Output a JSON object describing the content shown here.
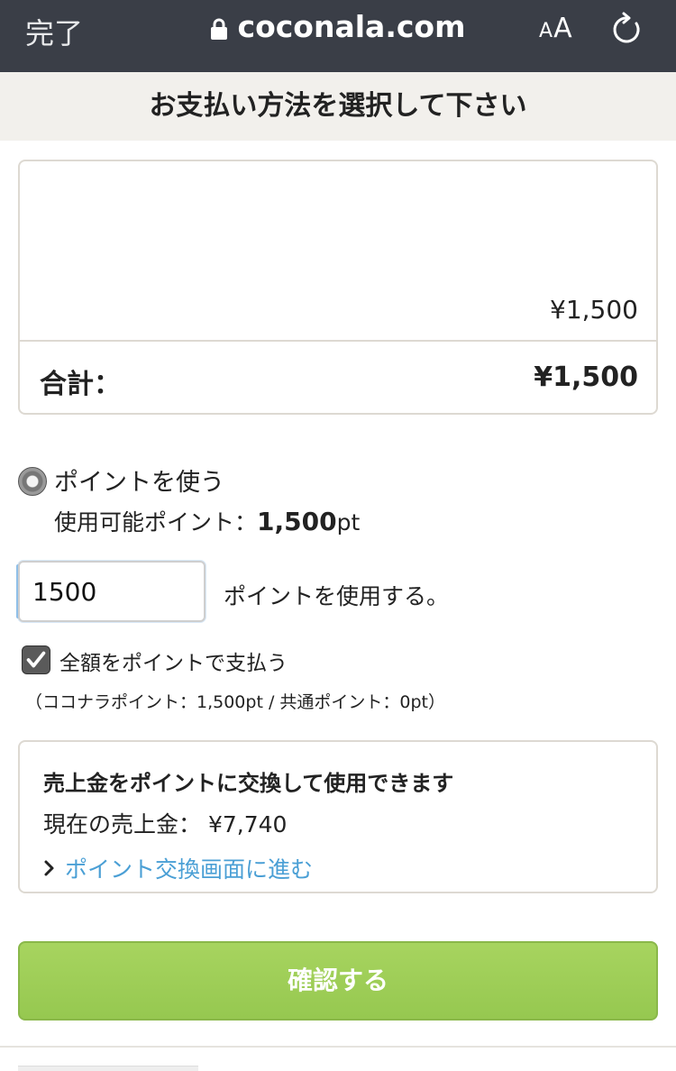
{
  "browser": {
    "done_label": "完了",
    "url": "coconala.com",
    "aa_small": "A",
    "aa_large": "A"
  },
  "page": {
    "title": "お支払い方法を選択して下さい"
  },
  "price_card": {
    "amount": "¥1,500",
    "total_label": "合計：",
    "total_value": "¥1,500"
  },
  "points": {
    "radio_label": "ポイントを使う",
    "available_prefix": "使用可能ポイント：",
    "available_value": "1,500",
    "available_unit": "pt",
    "input_value": "1500",
    "input_suffix": "ポイントを使用する。",
    "pay_all_label": "全額をポイントで支払う",
    "pay_all_checked": true,
    "breakdown": "（ココナラポイント：1,500pt / 共通ポイント：0pt）"
  },
  "sales": {
    "title": "売上金をポイントに交換して使用できます",
    "current_label": "現在の売上金：",
    "current_value": "¥7,740",
    "link_label": "ポイント交換画面に進む"
  },
  "actions": {
    "confirm_label": "確認する"
  },
  "colors": {
    "topbar": "#3a3e47",
    "title_bg": "#f2f0ec",
    "link": "#4a9fd5",
    "confirm_green": "#9dcd57"
  }
}
